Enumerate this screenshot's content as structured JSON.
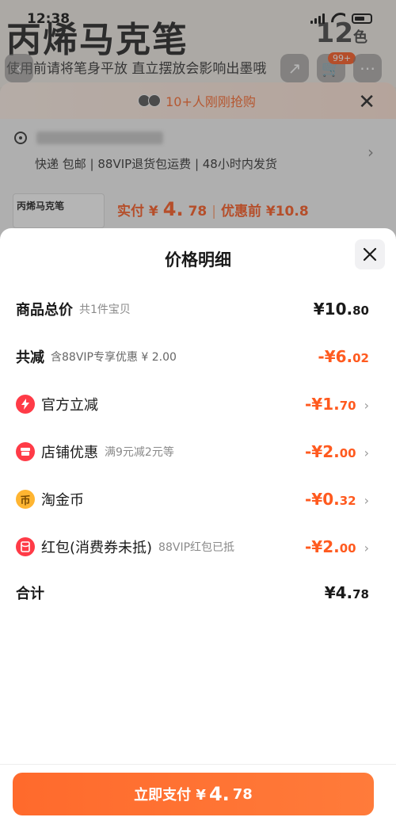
{
  "status_bar": {
    "time": "12:38"
  },
  "background": {
    "product_title": "丙烯马克笔",
    "subtitle": "使用前请将笔身平放 直立摆放会影响出墨哦",
    "count_value": "12",
    "count_unit": "色",
    "cart_badge": "99+",
    "promo_text": "10+人刚刚抢购",
    "shipping_text": "快递 包邮  |  88VIP退货包运费  |  48小时内发货",
    "thumb_title": "丙烯马克笔",
    "price_label": "实付 ¥",
    "price_int": "4.",
    "price_dec": "78",
    "price_before": "优惠前 ¥10.8"
  },
  "sheet": {
    "title": "价格明细",
    "rows": [
      {
        "label": "商品总价",
        "note": "共1件宝贝",
        "amount_int": "¥10.",
        "amount_dec": "80"
      },
      {
        "label": "共减",
        "note": "含88VIP专享优惠 ¥ 2.00",
        "amount_int": "-¥6.",
        "amount_dec": "02"
      },
      {
        "label": "官方立减",
        "note": "",
        "amount_int": "-¥1.",
        "amount_dec": "70"
      },
      {
        "label": "店铺优惠",
        "note": "满9元减2元等",
        "amount_int": "-¥2.",
        "amount_dec": "00"
      },
      {
        "label": "淘金币",
        "note": "",
        "amount_int": "-¥0.",
        "amount_dec": "32"
      },
      {
        "label": "红包(消费券未抵)",
        "note": "88VIP红包已抵",
        "amount_int": "-¥2.",
        "amount_dec": "00"
      },
      {
        "label": "合计",
        "note": "",
        "amount_int": "¥4.",
        "amount_dec": "78"
      }
    ],
    "icons": {
      "official": "lightning-icon",
      "shop": "shop-icon",
      "coin": "coin-icon",
      "hongbao": "red-packet-icon"
    }
  },
  "pay_button": {
    "label": "立即支付 ¥",
    "int": "4.",
    "dec": "78"
  },
  "colors": {
    "accent": "#ff5a1f",
    "button": "#ff6a2c",
    "icon_red": "#ff3b47",
    "coin_gold": "#ffb531"
  }
}
